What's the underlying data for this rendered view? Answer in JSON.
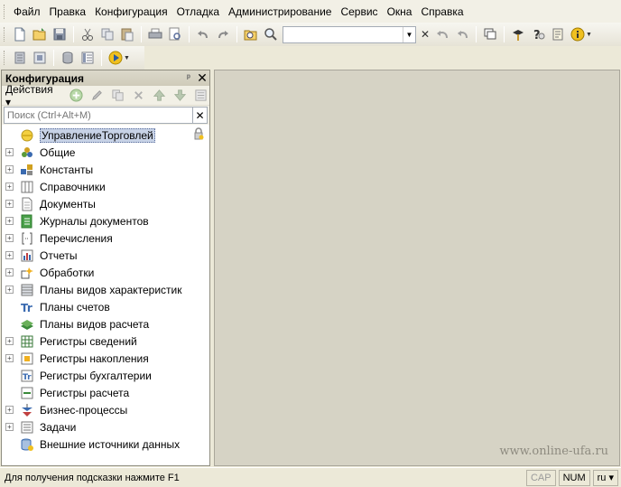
{
  "menu": [
    "Файл",
    "Правка",
    "Конфигурация",
    "Отладка",
    "Администрирование",
    "Сервис",
    "Окна",
    "Справка"
  ],
  "toolbar": {
    "search_value": "",
    "icons": [
      "new-icon",
      "open-icon",
      "save-icon",
      "cut-icon",
      "copy-icon",
      "paste-icon",
      "print-icon",
      "print-preview-icon",
      "undo-icon",
      "redo-icon",
      "find-in-tree-icon",
      "search-icon",
      "search-dropdown-icon",
      "search-clear-icon",
      "back-icon",
      "forward-icon",
      "windows-icon",
      "syntax-helper-icon",
      "help-icon",
      "help-contents-icon",
      "info-icon"
    ]
  },
  "toolbar2": {
    "icons": [
      "config-db-icon",
      "compare-icon",
      "database-icon",
      "list-icon",
      "run-icon"
    ]
  },
  "panel": {
    "title": "Конфигурация",
    "pin": "ᵖ",
    "close": "✕",
    "actions_label": "Действия",
    "search_placeholder": "Поиск (Ctrl+Alt+M)",
    "search_clear": "✕"
  },
  "tree": [
    {
      "label": "УправлениеТорговлей",
      "expander": "",
      "icon": "config-root-icon",
      "root": true
    },
    {
      "label": "Общие",
      "expander": "+",
      "icon": "common-icon"
    },
    {
      "label": "Константы",
      "expander": "+",
      "icon": "constants-icon"
    },
    {
      "label": "Справочники",
      "expander": "+",
      "icon": "catalogs-icon"
    },
    {
      "label": "Документы",
      "expander": "+",
      "icon": "documents-icon"
    },
    {
      "label": "Журналы документов",
      "expander": "+",
      "icon": "journals-icon"
    },
    {
      "label": "Перечисления",
      "expander": "+",
      "icon": "enums-icon"
    },
    {
      "label": "Отчеты",
      "expander": "+",
      "icon": "reports-icon"
    },
    {
      "label": "Обработки",
      "expander": "+",
      "icon": "dataprocessors-icon"
    },
    {
      "label": "Планы видов характеристик",
      "expander": "+",
      "icon": "chart-of-characteristics-icon"
    },
    {
      "label": "Планы счетов",
      "expander": "",
      "icon": "chart-of-accounts-icon"
    },
    {
      "label": "Планы видов расчета",
      "expander": "",
      "icon": "chart-of-calculation-icon"
    },
    {
      "label": "Регистры сведений",
      "expander": "+",
      "icon": "info-registers-icon"
    },
    {
      "label": "Регистры накопления",
      "expander": "+",
      "icon": "accumulation-registers-icon"
    },
    {
      "label": "Регистры бухгалтерии",
      "expander": "",
      "icon": "accounting-registers-icon"
    },
    {
      "label": "Регистры расчета",
      "expander": "",
      "icon": "calculation-registers-icon"
    },
    {
      "label": "Бизнес-процессы",
      "expander": "+",
      "icon": "business-processes-icon"
    },
    {
      "label": "Задачи",
      "expander": "+",
      "icon": "tasks-icon"
    },
    {
      "label": "Внешние источники данных",
      "expander": "",
      "icon": "external-sources-icon"
    }
  ],
  "watermark": "www.online-ufa.ru",
  "status": {
    "hint": "Для получения подсказки нажмите F1",
    "cap": "CAP",
    "num": "NUM",
    "lang": "ru"
  }
}
